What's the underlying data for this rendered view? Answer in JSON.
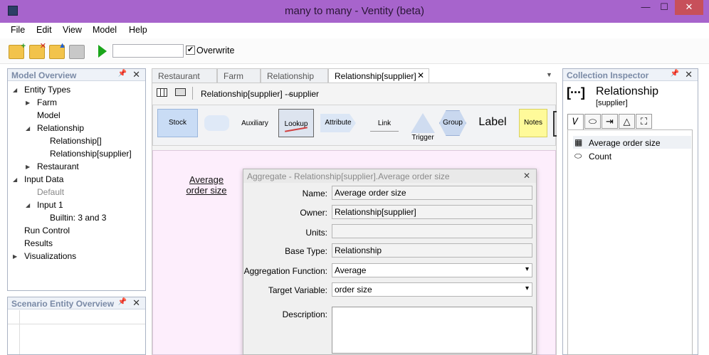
{
  "window": {
    "title": "many to many - Ventity (beta)",
    "min": "—",
    "max": "☐",
    "close": "✕"
  },
  "menu": [
    "File",
    "Edit",
    "View",
    "Model",
    "Help"
  ],
  "toolbar": {
    "run_input_value": "",
    "overwrite_label": "Overwrite",
    "overwrite_checked": "✔"
  },
  "model_overview": {
    "title": "Model Overview",
    "items": [
      {
        "label": "Entity Types",
        "expander": "◢",
        "style": ""
      },
      {
        "label": "Farm",
        "expander": "▶",
        "style": ""
      },
      {
        "label": "Model",
        "expander": "",
        "style": ""
      },
      {
        "label": "Relationship",
        "expander": "◢",
        "style": ""
      },
      {
        "label": "Relationship[]",
        "expander": "",
        "style": ""
      },
      {
        "label": "Relationship[supplier]",
        "expander": "",
        "style": ""
      },
      {
        "label": "Restaurant",
        "expander": "▶",
        "style": ""
      },
      {
        "label": "Input Data",
        "expander": "◢",
        "style": ""
      },
      {
        "label": "Default",
        "expander": "",
        "style": "grey"
      },
      {
        "label": "Input 1",
        "expander": "◢",
        "style": ""
      },
      {
        "label": "Builtin: 3 and 3",
        "expander": "",
        "style": ""
      },
      {
        "label": "Run Control",
        "expander": "",
        "style": ""
      },
      {
        "label": "Results",
        "expander": "",
        "style": ""
      },
      {
        "label": "Visualizations",
        "expander": "▶",
        "style": ""
      }
    ]
  },
  "scenario_overview": {
    "title": "Scenario Entity Overview"
  },
  "tabs": [
    {
      "label": "Restaurant"
    },
    {
      "label": "Farm"
    },
    {
      "label": "Relationship"
    },
    {
      "label": "Relationship[supplier]"
    }
  ],
  "doc_toolbar": {
    "breadcrumb": "Relationship[supplier] ---",
    "owner": "supplier"
  },
  "palette": {
    "stock": "Stock",
    "auxiliary": "Auxiliary",
    "lookup": "Lookup",
    "attribute": "Attribute",
    "link": "Link",
    "trigger": "Trigger",
    "group": "Group",
    "label": "Label",
    "notes": "Notes"
  },
  "canvas": {
    "node_label": "Average order size"
  },
  "dialog": {
    "title": "Aggregate - Relationship[supplier].Average order size",
    "name_label": "Name:",
    "name_value": "Average order size",
    "owner_label": "Owner:",
    "owner_value": "Relationship[supplier]",
    "units_label": "Units:",
    "units_value": "",
    "basetype_label": "Base Type:",
    "basetype_value": "Relationship",
    "aggfn_label": "Aggregation Function:",
    "aggfn_value": "Average",
    "target_label": "Target Variable:",
    "target_value": "order size",
    "desc_label": "Description:",
    "desc_value": ""
  },
  "inspector": {
    "panel_title": "Collection Inspector",
    "icon_text": "[···]",
    "title": "Relationship",
    "subtitle": "[supplier]",
    "tab_icons": [
      "𝑉",
      "⬭",
      "⇥",
      "△",
      "⛶"
    ],
    "items": [
      {
        "label": "Average order size",
        "icon": "▦"
      },
      {
        "label": "Count",
        "icon": "⬭"
      }
    ]
  }
}
